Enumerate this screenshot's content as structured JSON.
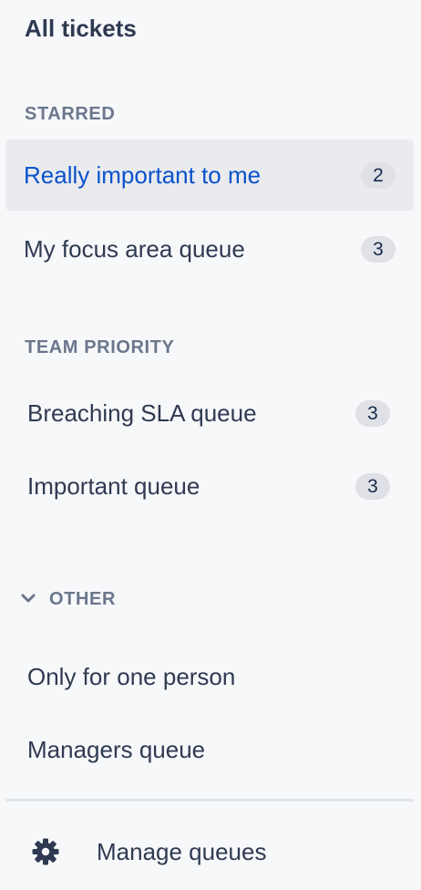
{
  "title": "All tickets",
  "sections": {
    "starred": {
      "heading": "STARRED",
      "items": [
        {
          "label": "Really important to me",
          "count": "2",
          "active": true
        },
        {
          "label": "My focus area queue",
          "count": "3",
          "active": false
        }
      ]
    },
    "team_priority": {
      "heading": "TEAM PRIORITY",
      "items": [
        {
          "label": "Breaching SLA queue",
          "count": "3"
        },
        {
          "label": "Important queue",
          "count": "3"
        }
      ]
    },
    "other": {
      "heading": "OTHER",
      "collapse_icon": "chevron-down-icon",
      "items": [
        {
          "label": "Only for one person"
        },
        {
          "label": "Managers queue"
        }
      ]
    }
  },
  "footer": {
    "manage_label": "Manage queues",
    "icon": "gear-icon"
  },
  "colors": {
    "active_text": "#0a52cc",
    "active_bg": "#e9ebee",
    "badge_bg": "#dfe1e6",
    "background": "#f7f8fa"
  }
}
